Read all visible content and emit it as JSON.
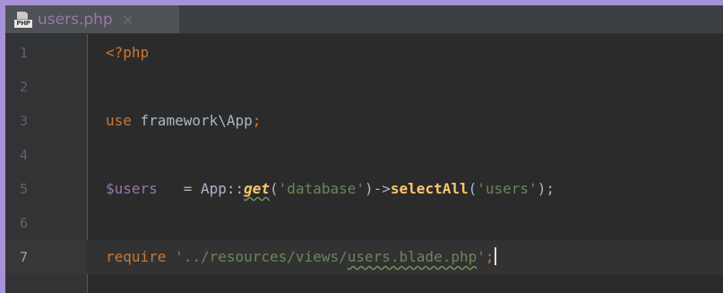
{
  "tab": {
    "icon": "php-file-icon",
    "icon_label": "PHP",
    "title": "users.php",
    "close_glyph": "×"
  },
  "editor": {
    "current_line": "7",
    "lines": [
      {
        "number": "1",
        "tokens": [
          {
            "text": "<?php",
            "kind": "kw"
          }
        ]
      },
      {
        "number": "2",
        "tokens": []
      },
      {
        "number": "3",
        "tokens": [
          {
            "text": "use",
            "kind": "kw"
          },
          {
            "text": " framework\\App",
            "kind": "plain"
          },
          {
            "text": ";",
            "kind": "kw"
          }
        ]
      },
      {
        "number": "4",
        "tokens": []
      },
      {
        "number": "5",
        "tokens": [
          {
            "text": "$users",
            "kind": "var"
          },
          {
            "text": "   = App::",
            "kind": "plain"
          },
          {
            "text": "get",
            "kind": "fn"
          },
          {
            "text": "(",
            "kind": "plain"
          },
          {
            "text": "'database'",
            "kind": "str"
          },
          {
            "text": ")->",
            "kind": "plain"
          },
          {
            "text": "selectAll",
            "kind": "method"
          },
          {
            "text": "(",
            "kind": "plain"
          },
          {
            "text": "'users'",
            "kind": "str"
          },
          {
            "text": ");",
            "kind": "plain"
          }
        ]
      },
      {
        "number": "6",
        "tokens": []
      },
      {
        "number": "7",
        "tokens": [
          {
            "text": "require",
            "kind": "kw"
          },
          {
            "text": " '../resources/views/",
            "kind": "str"
          },
          {
            "text": "users.blade.php",
            "kind": "str-typo"
          },
          {
            "text": "'",
            "kind": "str"
          },
          {
            "text": ";",
            "kind": "kw"
          }
        ]
      }
    ]
  },
  "colors": {
    "background": "#2b2b2b",
    "keyword": "#cc7832",
    "variable": "#9876aa",
    "string": "#6a8759",
    "method": "#ffc66d",
    "plain": "#a9b7c6"
  }
}
